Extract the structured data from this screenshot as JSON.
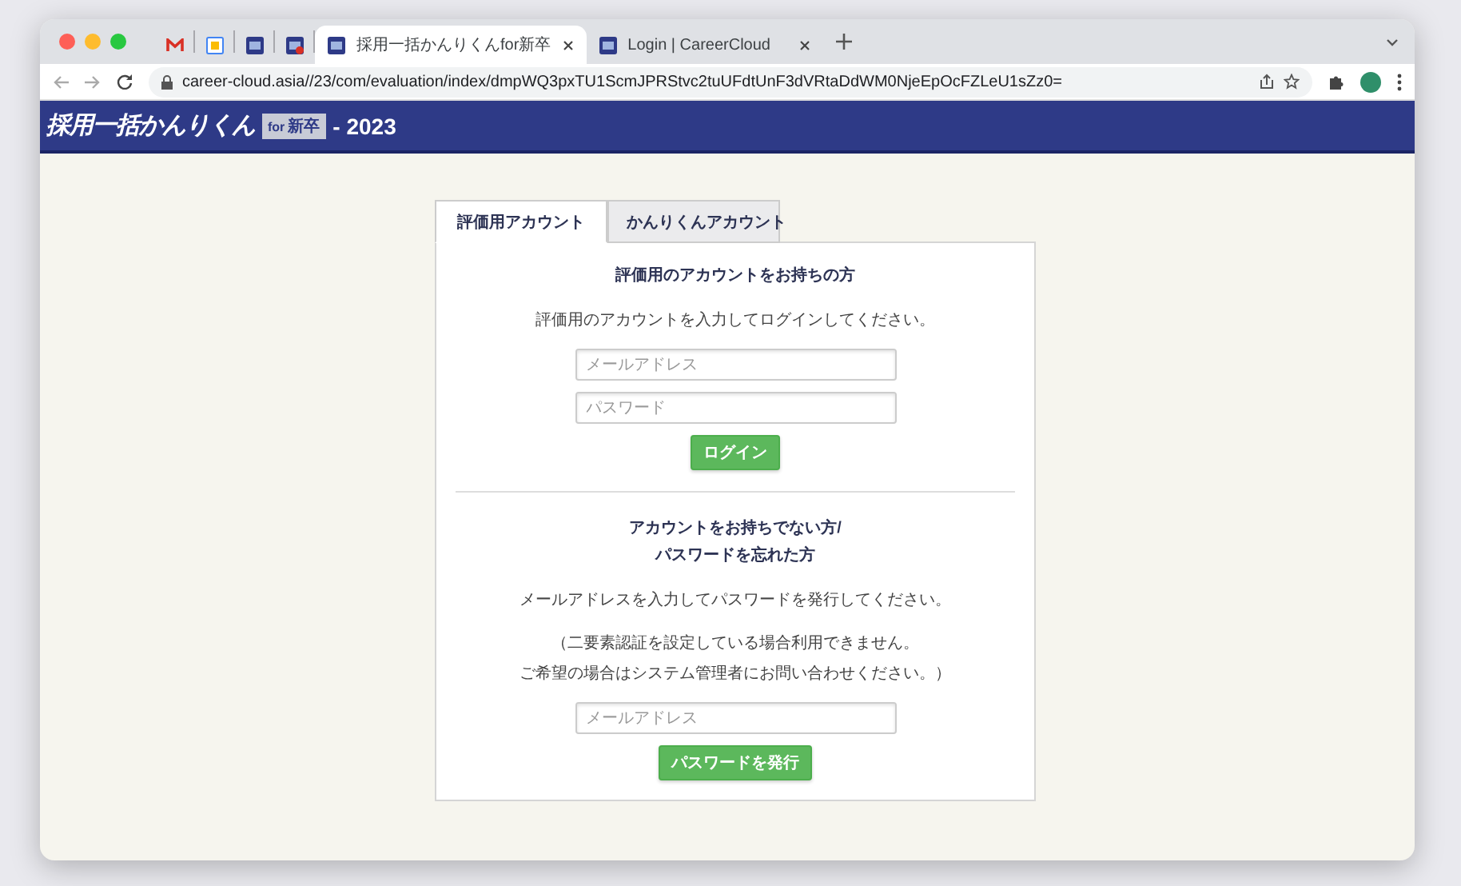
{
  "browser": {
    "tabs": [
      {
        "kind": "mail",
        "selected": false
      },
      {
        "kind": "calendar",
        "selected": false
      },
      {
        "kind": "app",
        "selected": false
      },
      {
        "kind": "app-alert",
        "selected": false
      },
      {
        "kind": "page",
        "title": "採用一括かんりくんfor新卒",
        "selected": true
      },
      {
        "kind": "page",
        "title": "Login | CareerCloud",
        "selected": false
      }
    ],
    "url": "career-cloud.asia//23/com/evaluation/index/dmpWQ3pxTU1ScmJPRStvc2tuUFdtUnF3dVRtaDdWM0NjeEpOcFZLeU1sZz0="
  },
  "header": {
    "logo": "採用一括かんりくん",
    "logo_badge_en": "for",
    "logo_badge": "新卒",
    "year": "- 2023"
  },
  "login_tabs": [
    {
      "label": "評価用アカウント",
      "selected": true
    },
    {
      "label": "かんりくんアカウント",
      "selected": false
    }
  ],
  "login": {
    "heading": "評価用のアカウントをお持ちの方",
    "text": "評価用のアカウントを入力してログインしてください。",
    "email_placeholder": "メールアドレス",
    "password_placeholder": "パスワード",
    "button": "ログイン"
  },
  "reset": {
    "heading_lines": [
      "アカウントをお持ちでない方/",
      "パスワードを忘れた方"
    ],
    "text": "メールアドレスを入力してパスワードを発行してください。",
    "note_lines": [
      "（二要素認証を設定している場合利用できません。",
      "ご希望の場合はシステム管理者にお問い合わせください。）"
    ],
    "email_placeholder": "メールアドレス",
    "button": "パスワードを発行"
  }
}
